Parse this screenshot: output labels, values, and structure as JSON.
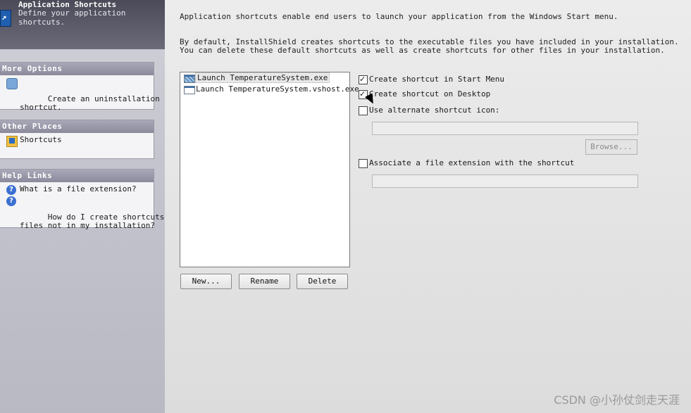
{
  "banner": {
    "title": "Application Shortcuts",
    "subtitle": "Define your application shortcuts."
  },
  "sidebar": {
    "more_options": {
      "header": "More Options",
      "items": [
        {
          "label": "Create an uninstallation\nshortcut.",
          "icon": "uninstall-shortcut-icon"
        }
      ]
    },
    "other_places": {
      "header": "Other Places",
      "items": [
        {
          "label": "Shortcuts",
          "icon": "shortcuts-folder-icon"
        }
      ]
    },
    "help_links": {
      "header": "Help Links",
      "items": [
        {
          "label": "What is a file extension?",
          "icon": "help-icon"
        },
        {
          "label": "How do I create shortcuts to\nfiles not in my installation?",
          "icon": "help-icon"
        }
      ]
    }
  },
  "main": {
    "intro_line1": "Application shortcuts enable end users to launch your application from the Windows Start menu.",
    "intro_line2": "By default, InstallShield creates shortcuts to the executable files you have included in your installation.",
    "intro_line3": "You can delete these default shortcuts as well as create shortcuts for other files in your installation.",
    "shortcuts": [
      {
        "label": "Launch TemperatureSystem.exe",
        "selected": true
      },
      {
        "label": "Launch TemperatureSystem.vshost.exe",
        "selected": false
      }
    ],
    "buttons": {
      "new": "New...",
      "rename": "Rename",
      "delete": "Delete"
    },
    "options": {
      "start_menu": {
        "label": "Create shortcut in Start Menu",
        "checked": true
      },
      "desktop": {
        "label": "Create shortcut on Desktop",
        "checked": true
      },
      "alt_icon": {
        "label": "Use alternate shortcut icon:",
        "checked": false
      },
      "file_ext": {
        "label": "Associate a file extension with the shortcut",
        "checked": false
      }
    },
    "alt_icon_path": "",
    "browse": "Browse...",
    "file_ext_value": ""
  },
  "watermark": "CSDN @小孙仗剑走天涯"
}
